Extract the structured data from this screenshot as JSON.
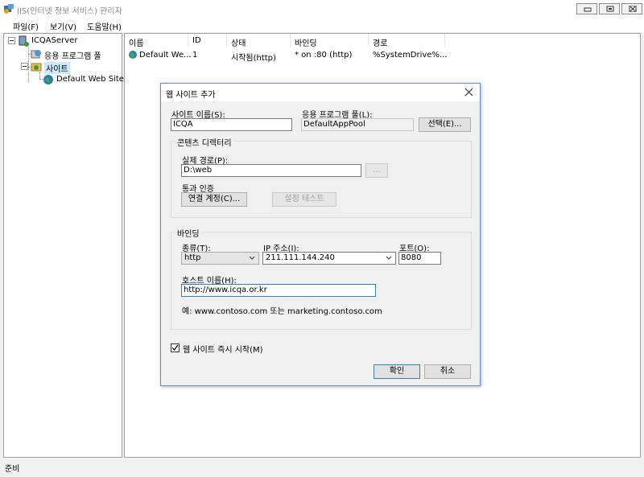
{
  "window": {
    "title": "IIS(인터넷 정보 서비스) 관리자"
  },
  "menu": {
    "file": "파일(F)",
    "view": "보기(V)",
    "help": "도움말(H)"
  },
  "tree": {
    "server": "ICQAServer",
    "app_pools": "응용 프로그램 풀",
    "sites": "사이트",
    "default_site": "Default Web Site"
  },
  "list": {
    "columns": {
      "name": "이름",
      "id": "ID",
      "status": "상태",
      "binding": "바인딩",
      "path": "경로"
    },
    "rows": [
      {
        "name": "Default We...",
        "id": "1",
        "status": "시작됨(http)",
        "binding": "* on :80 (http)",
        "path": "%SystemDrive%..."
      }
    ]
  },
  "status_bar": {
    "text": "준비"
  },
  "dialog": {
    "title": "웹 사이트 추가",
    "site_name_label": "사이트 이름(S):",
    "site_name_value": "ICQA",
    "app_pool_label": "응용 프로그램 풀(L):",
    "app_pool_value": "DefaultAppPool",
    "select_button": "선택(E)...",
    "content_dir_group": "콘텐츠 디렉터리",
    "physical_path_label": "실제 경로(P):",
    "physical_path_value": "D:\\web",
    "browse_button": "...",
    "pass_through_label": "통과 인증",
    "connect_as_button": "연결 계정(C)...",
    "test_settings_button": "설정 테스트",
    "binding_group": "바인딩",
    "type_label": "종류(T):",
    "type_value": "http",
    "ip_label": "IP 주소(I):",
    "ip_value": "211.111.144.240",
    "port_label": "포트(O):",
    "port_value": "8080",
    "host_label": "호스트 이름(H):",
    "host_value": "http://www.icqa.or.kr",
    "example_text": "예: www.contoso.com 또는 marketing.contoso.com",
    "start_now_label": "웹 사이트 즉시 시작(M)",
    "start_now_checked": true,
    "ok_button": "확인",
    "cancel_button": "취소"
  }
}
